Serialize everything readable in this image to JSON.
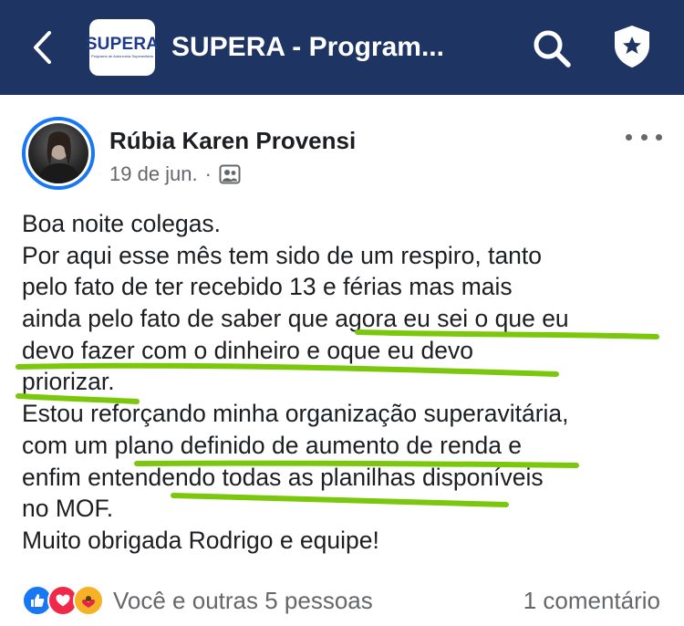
{
  "header": {
    "title": "SUPERA - Program...",
    "logo_text": "SUPERA",
    "logo_subtitle": "Programa de Autonomia Superavitária",
    "icons": [
      "back-arrow-icon",
      "search-icon",
      "admin-shield-star-icon"
    ]
  },
  "post": {
    "author": "Rúbia Karen Provensi",
    "date": "19 de jun.",
    "separator": "·",
    "audience_icon": "group-members-icon",
    "body_lines": [
      "Boa noite colegas.",
      "Por aqui esse mês tem sido de um respiro, tanto",
      "pelo fato de ter recebido 13 e férias mas mais",
      "ainda pelo fato de saber que agora eu sei o que eu",
      "devo fazer com o dinheiro  e oque eu devo",
      "priorizar.",
      "Estou reforçando minha organização superavitária,",
      "com um plano definido de aumento de renda e",
      "enfim entendendo todas as planilhas disponíveis",
      "no MOF.",
      "Muito obrigada Rodrigo e equipe!"
    ]
  },
  "footer": {
    "reactions_text": "Você e outras 5 pessoas",
    "comments_text": "1 comentário",
    "reaction_icons": [
      "like-icon",
      "love-icon",
      "care-icon"
    ]
  },
  "colors": {
    "header_bg": "#1e3564",
    "facebook_blue": "#1877f2",
    "highlight_green": "#7ac70c",
    "secondary_text": "#65676b"
  }
}
